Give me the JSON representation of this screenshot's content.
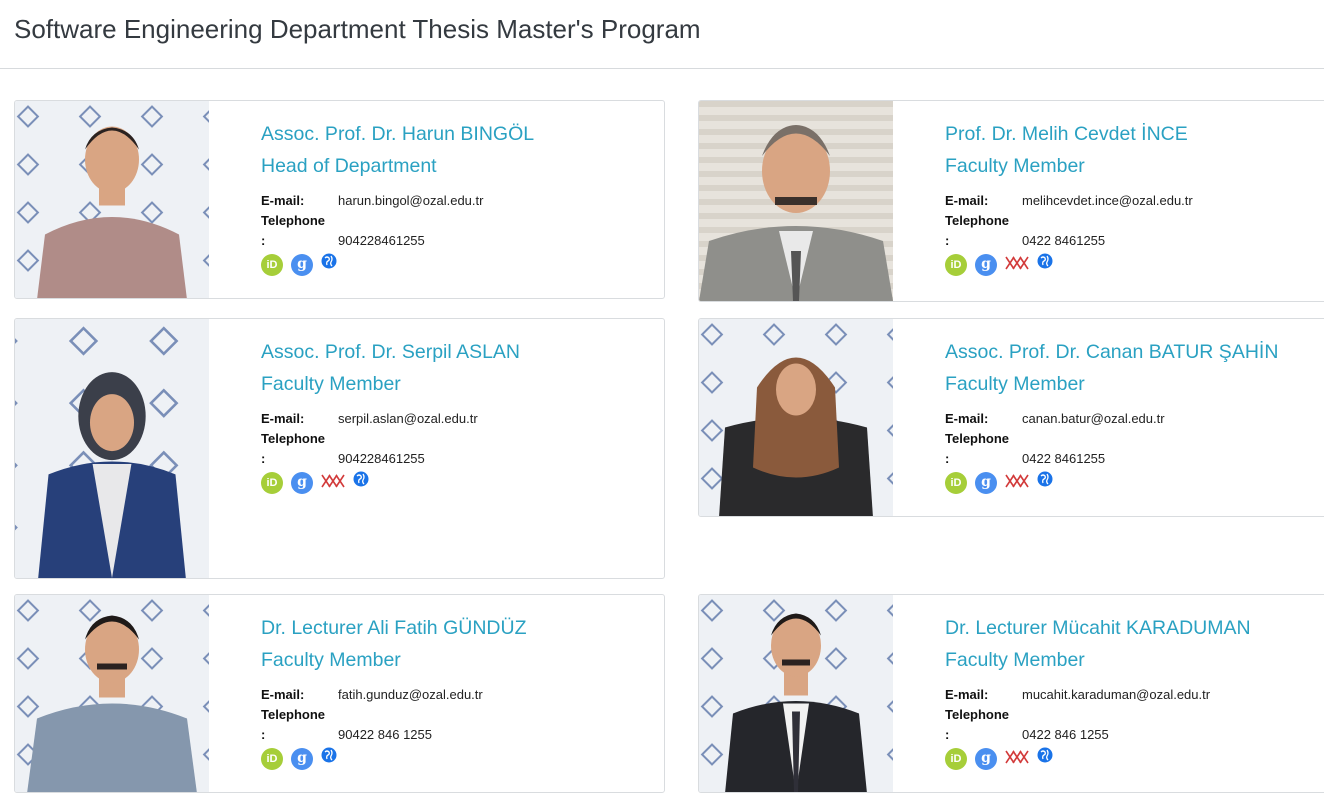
{
  "page": {
    "title": "Software Engineering Department Thesis Master's Program"
  },
  "labels": {
    "email": "E-mail:",
    "telephone": "Telephone",
    "colon": ":"
  },
  "colors": {
    "accent": "#2aa1c2",
    "orcid": "#a6ce39",
    "scholar": "#4a8ff0",
    "yok": "#d23a3a",
    "web": "#1a73e8"
  },
  "icons": [
    "orcid-icon",
    "google-scholar-icon",
    "yok-akademik-icon",
    "website-globe-icon"
  ],
  "faculty": [
    {
      "name": "Assoc. Prof. Dr. Harun BINGÖL",
      "role": "Head of Department",
      "email": "harun.bingol@ozal.edu.tr",
      "phone": "904228461255",
      "has_yok": false
    },
    {
      "name": "Prof. Dr. Melih Cevdet İNCE",
      "role": "Faculty Member",
      "email": "melihcevdet.ince@ozal.edu.tr",
      "phone": "0422 8461255",
      "has_yok": true
    },
    {
      "name": "Assoc. Prof. Dr. Serpil ASLAN",
      "role": "Faculty Member",
      "email": "serpil.aslan@ozal.edu.tr",
      "phone": "904228461255",
      "has_yok": true
    },
    {
      "name": "Assoc. Prof. Dr. Canan BATUR ŞAHİN",
      "role": "Faculty Member",
      "email": "canan.batur@ozal.edu.tr",
      "phone": "0422 8461255",
      "has_yok": true
    },
    {
      "name": "Dr. Lecturer Ali Fatih GÜNDÜZ",
      "role": "Faculty Member",
      "email": "fatih.gunduz@ozal.edu.tr",
      "phone": "90422 846 1255",
      "has_yok": false
    },
    {
      "name": "Dr. Lecturer Mücahit KARADUMAN",
      "role": "Faculty Member",
      "email": "mucahit.karaduman@ozal.edu.tr",
      "phone": "0422 846 1255",
      "has_yok": true
    }
  ]
}
